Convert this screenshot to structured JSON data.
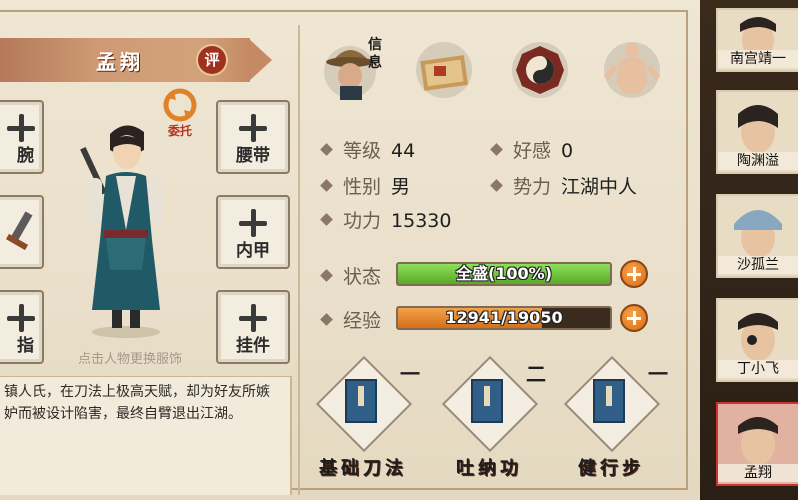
{
  "character": {
    "name": "孟翔",
    "evaluate_label": "评",
    "entrust_label": "委托",
    "change_outfit_hint": "点击人物更换服饰",
    "bio": "镇人氏，在刀法上极高天赋，却为好友所嫉妒而被设计陷害，最终自臂退出江湖。"
  },
  "equipment": {
    "left_slots": [
      "腕",
      "",
      "指"
    ],
    "right_slots": [
      "腰带",
      "内甲",
      "挂件"
    ]
  },
  "tabs": [
    {
      "label": "信息",
      "icon": "info-tab-icon"
    },
    {
      "label": "",
      "icon": "map-scroll-icon"
    },
    {
      "label": "",
      "icon": "bagua-icon"
    },
    {
      "label": "",
      "icon": "meridian-body-icon"
    }
  ],
  "stats": {
    "level_label": "等级",
    "level_value": "44",
    "favor_label": "好感",
    "favor_value": "0",
    "gender_label": "性别",
    "gender_value": "男",
    "faction_label": "势力",
    "faction_value": "江湖中人",
    "power_label": "功力",
    "power_value": "15330",
    "status_label": "状态",
    "status_text": "全盛(100%)",
    "status_fraction": 1.0,
    "exp_label": "经验",
    "exp_text": "12941/19050",
    "exp_fraction": 0.679
  },
  "skills": [
    {
      "name": "基础刀法",
      "level": "一"
    },
    {
      "name": "吐纳功",
      "level": "二"
    },
    {
      "name": "健行步",
      "level": "一"
    }
  ],
  "roster": [
    {
      "name": "南宫靖一"
    },
    {
      "name": "陶渊溢"
    },
    {
      "name": "沙孤兰"
    },
    {
      "name": "丁小飞"
    },
    {
      "name": "孟翔"
    }
  ],
  "colors": {
    "status_bar": "#6fbf3a",
    "exp_bar": "#e0862a",
    "accent_red": "#a0311f"
  }
}
